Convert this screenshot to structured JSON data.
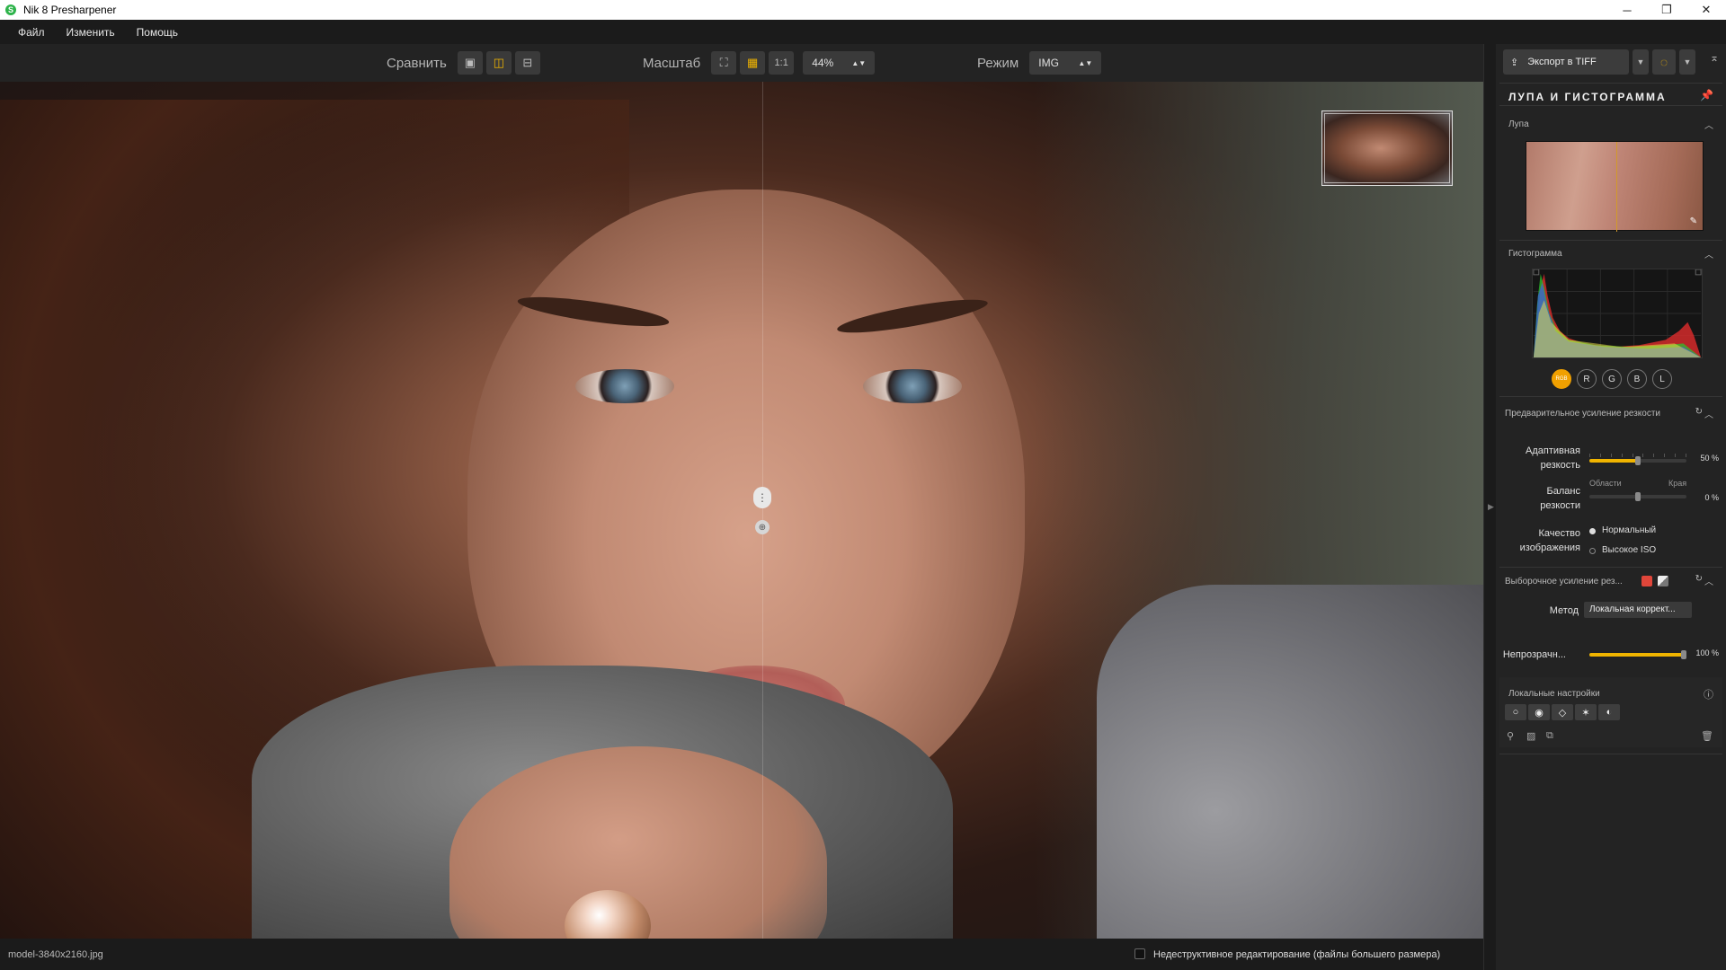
{
  "window": {
    "title": "Nik 8 Presharpener",
    "minimize": "─",
    "restore": "❐",
    "close": "✕"
  },
  "menu": [
    "Файл",
    "Изменить",
    "Помощь"
  ],
  "toolbar": {
    "compare_label": "Сравнить",
    "scale_label": "Масштаб",
    "one_to_one": "1:1",
    "zoom_value": "44%",
    "mode_label": "Режим",
    "mode_value": "IMG"
  },
  "status": {
    "filename": "model-3840x2160.jpg",
    "nondestructive_label": "Недеструктивное редактирование (файлы большего размера)"
  },
  "panel": {
    "export_label": "Экспорт в TIFF",
    "section_title": "ЛУПА И ГИСТОГРАММА",
    "loupe_label": "Лупа",
    "histogram_label": "Гистограмма",
    "hist_channels": [
      "RGB",
      "R",
      "G",
      "B",
      "L"
    ],
    "presharpen_title": "Предварительное усиление резкости",
    "adaptive_label_1": "Адаптивная",
    "adaptive_label_2": "резкость",
    "adaptive_value": "50 %",
    "adaptive_level": 0.5,
    "balance_label_1": "Баланс",
    "balance_label_2": "резкости",
    "balance_left": "Области",
    "balance_right": "Края",
    "balance_value": "0 %",
    "quality_label_1": "Качество",
    "quality_label_2": "изображения",
    "quality_option_1": "Нормальный",
    "quality_option_2": "Высокое ISO",
    "selective_title": "Выборочное усиление рез...",
    "method_label": "Метод",
    "method_value": "Локальная коррект...",
    "opacity_label": "Непрозрачн...",
    "opacity_value": "100 %",
    "opacity_level": 1.0,
    "local_title": "Локальные настройки"
  },
  "colors": {
    "accent": "#f0b400",
    "selective_swatch": "#e0463a"
  }
}
